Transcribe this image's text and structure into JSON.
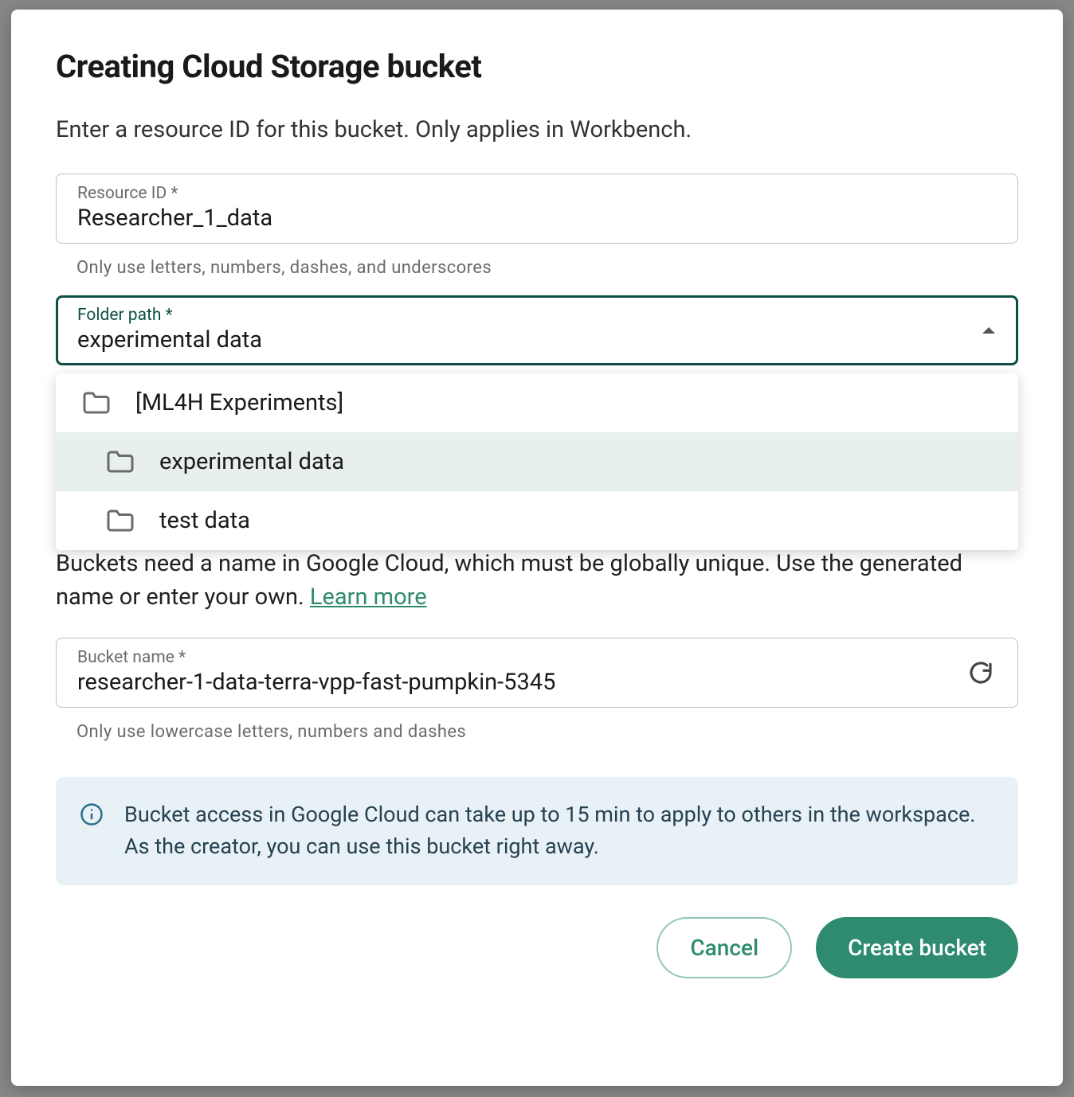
{
  "backdrop_fragment": "",
  "modal": {
    "title": "Creating Cloud Storage bucket",
    "subtitle": "Enter a resource ID for this bucket. Only applies in Workbench.",
    "resource_id": {
      "label": "Resource ID *",
      "value": "Researcher_1_data",
      "helper": "Only use letters, numbers, dashes, and underscores"
    },
    "folder_path": {
      "label": "Folder path *",
      "value": "experimental data",
      "options": [
        {
          "label": "[ML4H Experiments]",
          "level": 0,
          "selected": false
        },
        {
          "label": "experimental data",
          "level": 1,
          "selected": true
        },
        {
          "label": "test data",
          "level": 1,
          "selected": false
        }
      ]
    },
    "bucket_info_text_pre": "Buckets need a name in Google Cloud, which must be globally unique. Use the generated name or enter your own. ",
    "bucket_info_link": "Learn more",
    "bucket_name": {
      "label": "Bucket name *",
      "value": "researcher-1-data-terra-vpp-fast-pumpkin-5345",
      "helper": "Only use lowercase letters, numbers and dashes"
    },
    "info_banner": "Bucket access in Google Cloud can take up to 15 min to apply to others in the workspace. As the creator, you can use this bucket right away.",
    "buttons": {
      "cancel": "Cancel",
      "create": "Create bucket"
    }
  },
  "colors": {
    "accent": "#2e8b70",
    "focus_border": "#0d4f44",
    "info_bg": "#e8f1f6"
  }
}
